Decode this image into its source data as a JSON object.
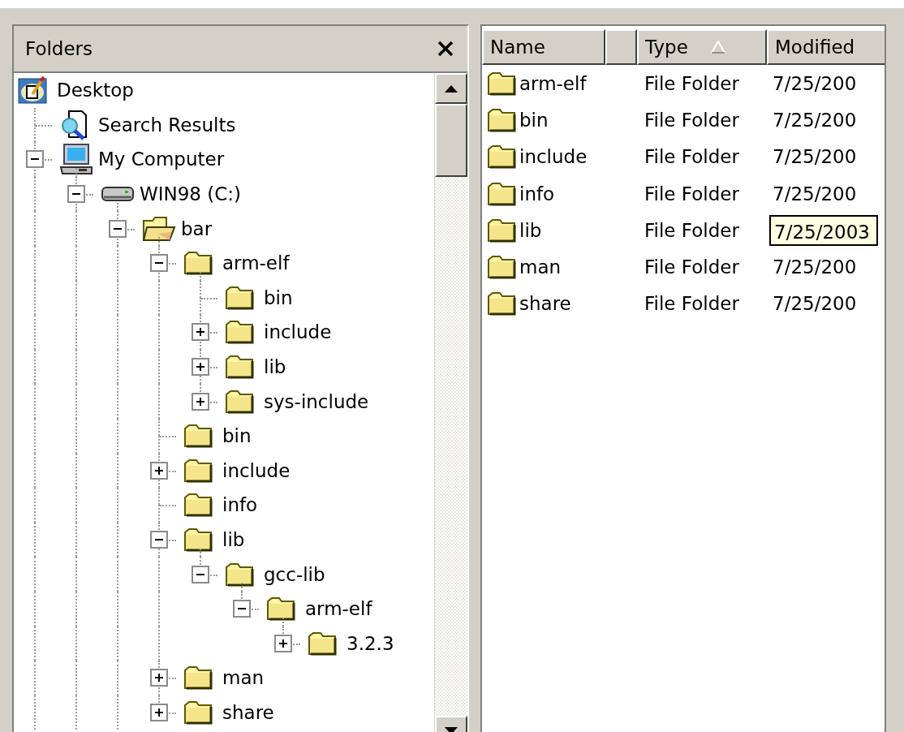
{
  "folders_pane": {
    "title": "Folders"
  },
  "tree": [
    {
      "label": "Desktop",
      "kind": "desktop",
      "children": [
        {
          "label": "Search Results",
          "kind": "search"
        },
        {
          "label": "My Computer",
          "kind": "computer",
          "expanded": true,
          "more_below": true,
          "children": [
            {
              "label": "WIN98 (C:)",
              "kind": "drive",
              "expanded": true,
              "more_below": true,
              "children": [
                {
                  "label": "bar",
                  "kind": "folder_open",
                  "expanded": true,
                  "more_below": true,
                  "children": [
                    {
                      "label": "arm-elf",
                      "kind": "folder",
                      "expanded": true,
                      "children": [
                        {
                          "label": "bin",
                          "kind": "folder"
                        },
                        {
                          "label": "include",
                          "kind": "folder",
                          "expanded": false
                        },
                        {
                          "label": "lib",
                          "kind": "folder",
                          "expanded": false
                        },
                        {
                          "label": "sys-include",
                          "kind": "folder",
                          "expanded": false
                        }
                      ]
                    },
                    {
                      "label": "bin",
                      "kind": "folder"
                    },
                    {
                      "label": "include",
                      "kind": "folder",
                      "expanded": false
                    },
                    {
                      "label": "info",
                      "kind": "folder"
                    },
                    {
                      "label": "lib",
                      "kind": "folder",
                      "expanded": true,
                      "children": [
                        {
                          "label": "gcc-lib",
                          "kind": "folder",
                          "expanded": true,
                          "children": [
                            {
                              "label": "arm-elf",
                              "kind": "folder",
                              "expanded": true,
                              "children": [
                                {
                                  "label": "3.2.3",
                                  "kind": "folder",
                                  "expanded": false
                                }
                              ]
                            }
                          ]
                        }
                      ]
                    },
                    {
                      "label": "man",
                      "kind": "folder",
                      "expanded": false
                    },
                    {
                      "label": "share",
                      "kind": "folder",
                      "expanded": false
                    }
                  ]
                }
              ]
            }
          ]
        }
      ]
    }
  ],
  "list": {
    "columns": [
      {
        "label": "Name",
        "sorted": false
      },
      {
        "sorted": false
      },
      {
        "label": "Type",
        "sorted": true
      },
      {
        "label": "Modified",
        "sorted": false
      }
    ],
    "rows": [
      {
        "name": "arm-elf",
        "type": "File Folder",
        "modified": "7/25/200"
      },
      {
        "name": "bin",
        "type": "File Folder",
        "modified": "7/25/200"
      },
      {
        "name": "include",
        "type": "File Folder",
        "modified": "7/25/200"
      },
      {
        "name": "info",
        "type": "File Folder",
        "modified": "7/25/200"
      },
      {
        "name": "lib",
        "type": "File Folder",
        "tooltip": "7/25/2003"
      },
      {
        "name": "man",
        "type": "File Folder",
        "modified": "7/25/200"
      },
      {
        "name": "share",
        "type": "File Folder",
        "modified": "7/25/200"
      }
    ]
  }
}
